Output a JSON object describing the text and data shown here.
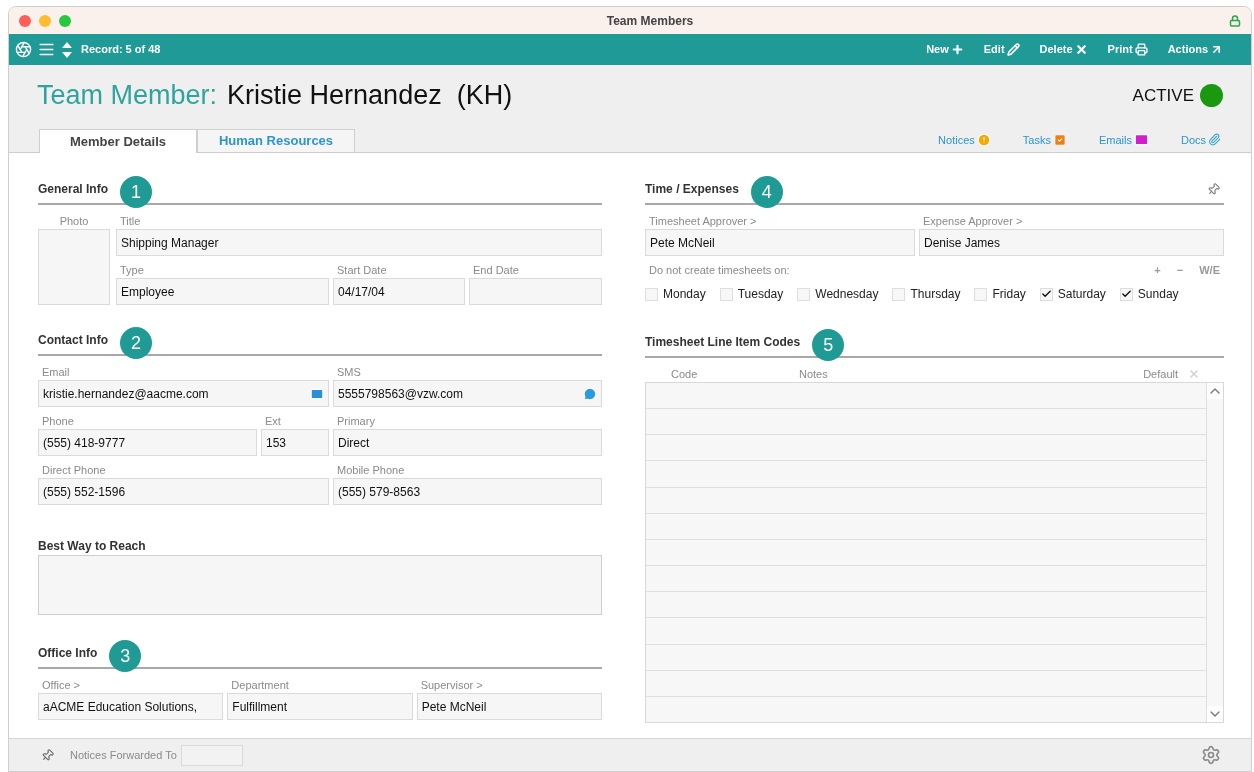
{
  "window": {
    "title": "Team Members"
  },
  "toolbar": {
    "record": "Record: 5 of 48",
    "actions": [
      {
        "label": "New",
        "kind": "new"
      },
      {
        "label": "Edit",
        "kind": "edit"
      },
      {
        "label": "Delete",
        "kind": "delete"
      },
      {
        "label": "Print",
        "kind": "print"
      },
      {
        "label": "Actions",
        "kind": "actions"
      }
    ]
  },
  "header": {
    "prefix": "Team Member:",
    "name": "Kristie Hernandez  (KH)",
    "status": "ACTIVE"
  },
  "tabs": [
    {
      "label": "Member Details",
      "selected": true
    },
    {
      "label": "Human Resources",
      "selected": false
    }
  ],
  "links": [
    {
      "label": "Notices",
      "kind": "notices"
    },
    {
      "label": "Tasks",
      "kind": "tasks"
    },
    {
      "label": "Emails",
      "kind": "emails"
    },
    {
      "label": "Docs",
      "kind": "docs"
    }
  ],
  "general_info": {
    "heading": "General Info",
    "badge": "1",
    "photo_label": "Photo",
    "fields": [
      {
        "label": "Title",
        "value": "Shipping Manager"
      },
      {
        "label": "Type",
        "value": "Employee"
      },
      {
        "label": "Start Date",
        "value": "04/17/04"
      },
      {
        "label": "End Date"
      }
    ]
  },
  "contact_info": {
    "heading": "Contact Info",
    "badge": "2",
    "fields": [
      {
        "label": "Email",
        "value": "kristie.hernandez@aacme.com",
        "kind": "email"
      },
      {
        "label": "SMS",
        "value": "5555798563@vzw.com",
        "kind": "sms"
      },
      {
        "label": "Phone",
        "value": "(555) 418-9777",
        "kind": "text"
      },
      {
        "label": "Ext",
        "value": "153",
        "kind": "text"
      },
      {
        "label": "Primary",
        "value": "Direct",
        "kind": "text"
      },
      {
        "label": "Direct Phone",
        "value": "(555) 552-1596",
        "kind": "text"
      },
      {
        "label": "Mobile Phone",
        "value": "(555) 579-8563",
        "kind": "text"
      }
    ]
  },
  "best_way": {
    "heading": "Best Way to Reach"
  },
  "office_info": {
    "heading": "Office Info",
    "badge": "3",
    "fields": [
      {
        "label": "Office >",
        "value": "aACME Education Solutions,"
      },
      {
        "label": "Department",
        "value": "Fulfillment"
      },
      {
        "label": "Supervisor >",
        "value": "Pete McNeil"
      }
    ]
  },
  "time_expenses": {
    "heading": "Time / Expenses",
    "badge": "4",
    "fields": [
      {
        "label": "Timesheet Approver >",
        "value": "Pete McNeil"
      },
      {
        "label": "Expense Approver >",
        "value": "Denise James"
      }
    ],
    "days_label": "Do not create timesheets on:",
    "day_controls": [
      "+",
      "−",
      "W/E"
    ],
    "days": [
      {
        "label": "Monday",
        "checked": false
      },
      {
        "label": "Tuesday",
        "checked": false
      },
      {
        "label": "Wednesday",
        "checked": false
      },
      {
        "label": "Thursday",
        "checked": false
      },
      {
        "label": "Friday",
        "checked": false
      },
      {
        "label": "Saturday",
        "checked": true
      },
      {
        "label": "Sunday",
        "checked": true
      }
    ]
  },
  "line_item_codes": {
    "heading": "Timesheet Line Item Codes",
    "badge": "5",
    "columns": [
      "Code",
      "Notes",
      "Default"
    ]
  },
  "footer": {
    "label": "Notices Forwarded To"
  }
}
